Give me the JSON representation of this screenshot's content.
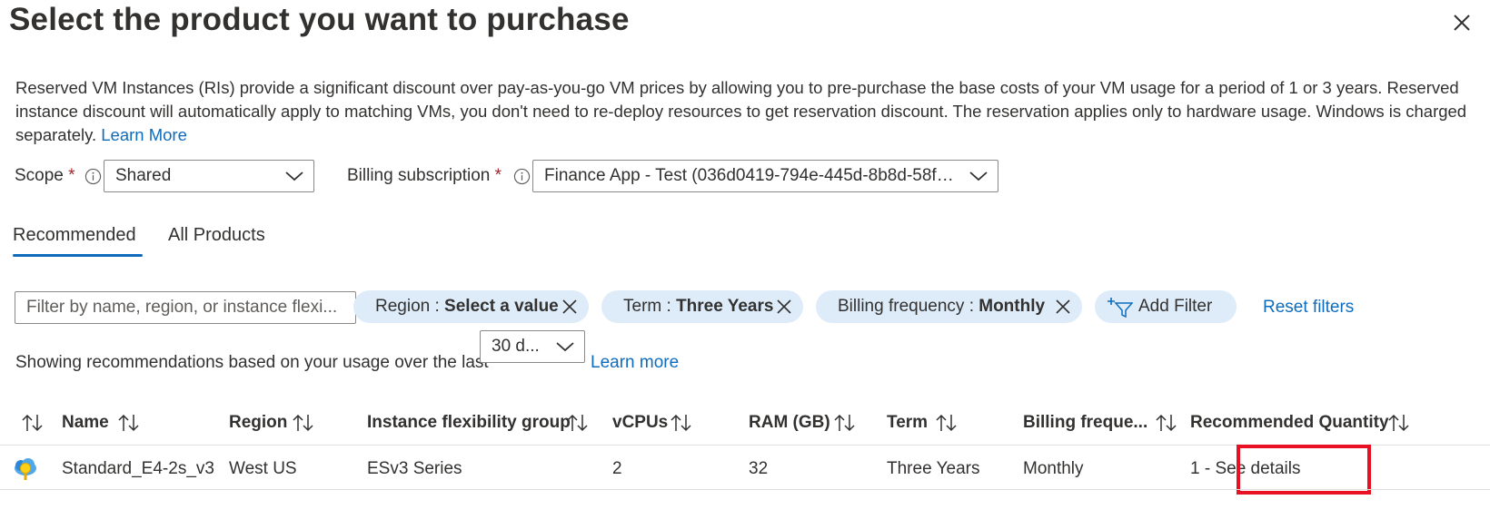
{
  "header": {
    "title": "Select the product you want to purchase"
  },
  "description": {
    "text": "Reserved VM Instances (RIs) provide a significant discount over pay-as-you-go VM prices by allowing you to pre-purchase the base costs of your VM usage for a period of 1 or 3 years. Reserved instance discount will automatically apply to matching VMs, you don't need to re-deploy resources to get reservation discount. The reservation applies only to hardware usage. Windows is charged separately.",
    "link": "Learn More"
  },
  "scope": {
    "label": "Scope",
    "required_mark": "*",
    "value": "Shared"
  },
  "billing": {
    "label": "Billing subscription",
    "required_mark": "*",
    "value": "Finance App - Test (036d0419-794e-445d-8b8d-58f28..."
  },
  "tabs": [
    {
      "label": "Recommended",
      "active": true
    },
    {
      "label": "All Products",
      "active": false
    }
  ],
  "filter": {
    "placeholder": "Filter by name, region, or instance flexi...",
    "pills": [
      {
        "key": "Region : ",
        "value": "Select a value"
      },
      {
        "key": "Term : ",
        "value": "Three Years"
      },
      {
        "key": "Billing frequency : ",
        "value": "Monthly"
      }
    ],
    "add_filter": "Add Filter",
    "reset": "Reset filters"
  },
  "usage": {
    "text": "Showing recommendations based on your usage over the last",
    "period": "30 d...",
    "link": "Learn more"
  },
  "table": {
    "headers": [
      "Name",
      "Region",
      "Instance flexibility group",
      "vCPUs",
      "RAM (GB)",
      "Term",
      "Billing freque...",
      "Recommended Quantity"
    ],
    "rows": [
      {
        "icon": "vm-reservation-icon",
        "name": "Standard_E4-2s_v3",
        "region": "West US",
        "group": "ESv3 Series",
        "vcpus": "2",
        "ram": "32",
        "term": "Three Years",
        "billing": "Monthly",
        "quantity": "1 - See details"
      }
    ]
  },
  "colors": {
    "accent": "#0f6cbd",
    "pill_bg": "#deecf9",
    "highlight": "#e81123",
    "required": "#a4262c"
  }
}
